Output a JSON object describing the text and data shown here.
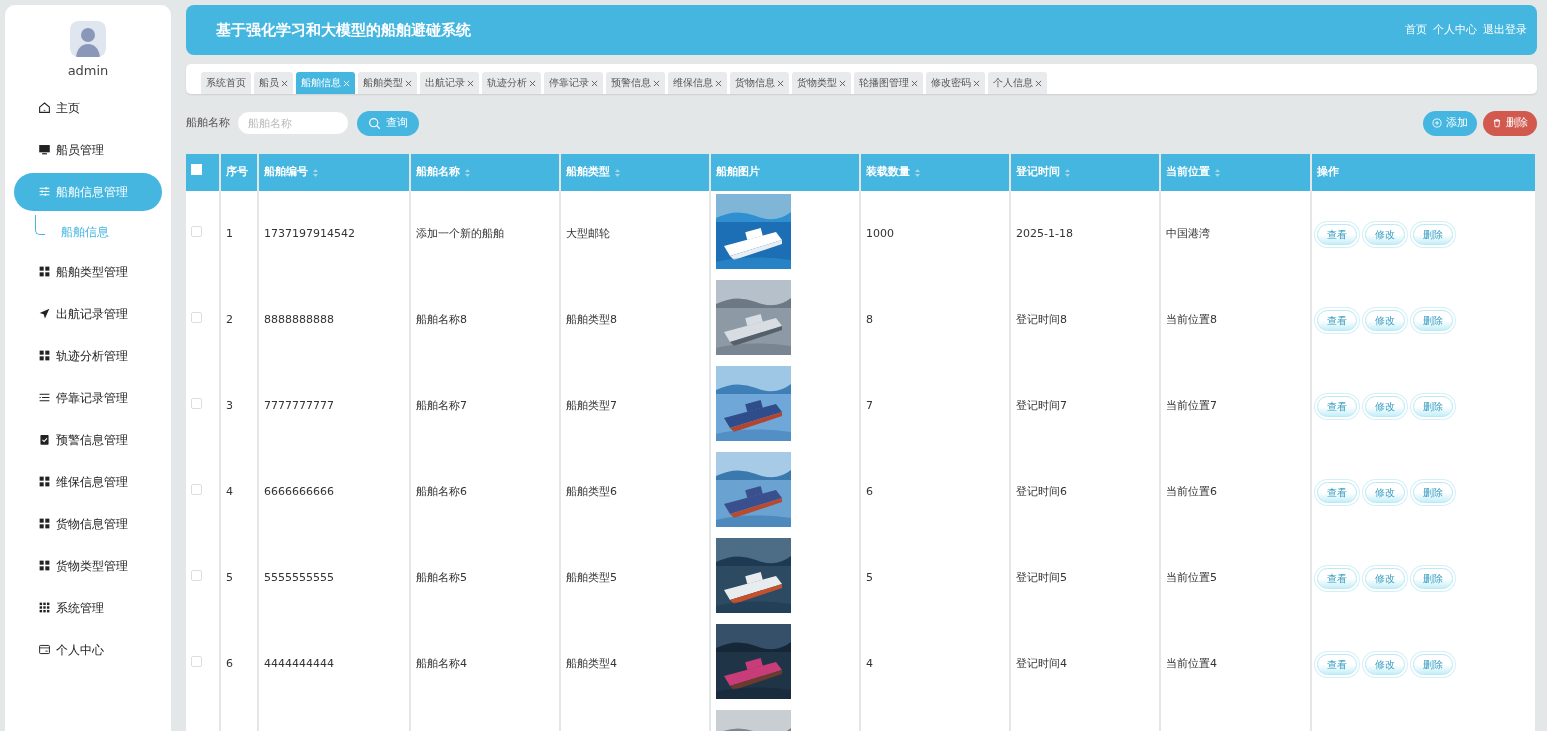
{
  "sidebar": {
    "user": "admin",
    "items": [
      {
        "label": "主页",
        "selected": false
      },
      {
        "label": "船员管理",
        "selected": false
      },
      {
        "label": "船舶信息管理",
        "selected": true,
        "expanded": true,
        "children": [
          {
            "label": "船舶信息",
            "selected": true
          }
        ]
      },
      {
        "label": "船舶类型管理",
        "selected": false
      },
      {
        "label": "出航记录管理",
        "selected": false
      },
      {
        "label": "轨迹分析管理",
        "selected": false
      },
      {
        "label": "停靠记录管理",
        "selected": false
      },
      {
        "label": "预警信息管理",
        "selected": false
      },
      {
        "label": "维保信息管理",
        "selected": false
      },
      {
        "label": "货物信息管理",
        "selected": false
      },
      {
        "label": "货物类型管理",
        "selected": false
      },
      {
        "label": "系统管理",
        "selected": false
      },
      {
        "label": "个人中心",
        "selected": false
      }
    ]
  },
  "header": {
    "title": "基于强化学习和大模型的船舶避碰系统",
    "links": [
      "首页",
      "个人中心",
      "退出登录"
    ]
  },
  "tabs": [
    {
      "label": "系统首页",
      "selected": false,
      "closable": false
    },
    {
      "label": "船员",
      "selected": false,
      "closable": true
    },
    {
      "label": "船舶信息",
      "selected": true,
      "closable": true
    },
    {
      "label": "船舶类型",
      "selected": false,
      "closable": true
    },
    {
      "label": "出航记录",
      "selected": false,
      "closable": true
    },
    {
      "label": "轨迹分析",
      "selected": false,
      "closable": true
    },
    {
      "label": "停靠记录",
      "selected": false,
      "closable": true
    },
    {
      "label": "预警信息",
      "selected": false,
      "closable": true
    },
    {
      "label": "维保信息",
      "selected": false,
      "closable": true
    },
    {
      "label": "货物信息",
      "selected": false,
      "closable": true
    },
    {
      "label": "货物类型",
      "selected": false,
      "closable": true
    },
    {
      "label": "轮播图管理",
      "selected": false,
      "closable": true
    },
    {
      "label": "修改密码",
      "selected": false,
      "closable": true
    },
    {
      "label": "个人信息",
      "selected": false,
      "closable": true
    }
  ],
  "search": {
    "label": "船舶名称",
    "placeholder": "船舶名称",
    "button": "查询"
  },
  "actions": [
    {
      "label": "添加",
      "kind": "add"
    },
    {
      "label": "删除",
      "kind": "delete"
    }
  ],
  "table": {
    "columns": [
      {
        "label": "序号",
        "sortable": false
      },
      {
        "label": "船舶编号",
        "sortable": true
      },
      {
        "label": "船舶名称",
        "sortable": true
      },
      {
        "label": "船舶类型",
        "sortable": true
      },
      {
        "label": "船舶图片",
        "sortable": false
      },
      {
        "label": "装载数量",
        "sortable": true
      },
      {
        "label": "登记时间",
        "sortable": true
      },
      {
        "label": "当前位置",
        "sortable": true
      },
      {
        "label": "操作",
        "sortable": false
      }
    ],
    "select_all": false,
    "rows": [
      {
        "checked": false,
        "cells": [
          "1",
          "1737197914542",
          "添加一个新的船舶",
          "大型邮轮",
          "",
          "1000",
          "2025-1-18",
          "中国港湾"
        ],
        "buttons": [
          "查看",
          "修改",
          "删除"
        ]
      },
      {
        "checked": false,
        "cells": [
          "2",
          "8888888888",
          "船舶名称8",
          "船舶类型8",
          "",
          "8",
          "登记时间8",
          "当前位置8"
        ],
        "buttons": [
          "查看",
          "修改",
          "删除"
        ]
      },
      {
        "checked": false,
        "cells": [
          "3",
          "7777777777",
          "船舶名称7",
          "船舶类型7",
          "",
          "7",
          "登记时间7",
          "当前位置7"
        ],
        "buttons": [
          "查看",
          "修改",
          "删除"
        ]
      },
      {
        "checked": false,
        "cells": [
          "4",
          "6666666666",
          "船舶名称6",
          "船舶类型6",
          "",
          "6",
          "登记时间6",
          "当前位置6"
        ],
        "buttons": [
          "查看",
          "修改",
          "删除"
        ]
      },
      {
        "checked": false,
        "cells": [
          "5",
          "5555555555",
          "船舶名称5",
          "船舶类型5",
          "",
          "5",
          "登记时间5",
          "当前位置5"
        ],
        "buttons": [
          "查看",
          "修改",
          "删除"
        ]
      },
      {
        "checked": false,
        "cells": [
          "6",
          "4444444444",
          "船舶名称4",
          "船舶类型4",
          "",
          "4",
          "登记时间4",
          "当前位置4"
        ],
        "buttons": [
          "查看",
          "修改",
          "删除"
        ]
      },
      {
        "cells": []
      }
    ]
  }
}
